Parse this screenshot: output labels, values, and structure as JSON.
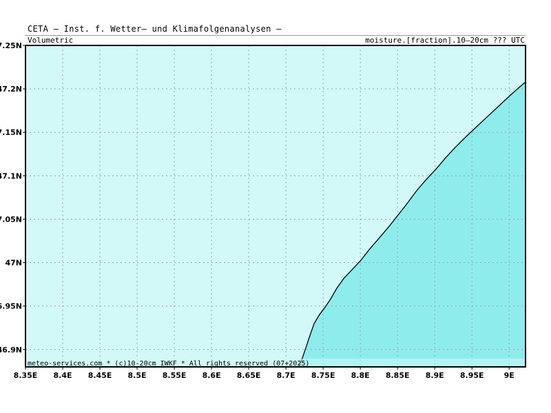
{
  "header": {
    "title": "CETA — Inst. f. Wetter— und Klimafolgenanalysen —",
    "left_label": "Volumetric",
    "right_label": "moisture.[fraction].10—20cm  ???  UTC"
  },
  "footer": {
    "copyright": "meteo-services.com * (c)10-20cm IWKF * All rights reserved (07+2025)"
  },
  "map": {
    "lon_range": [
      8.35,
      9.022
    ],
    "lat_range": [
      46.88,
      7.25
    ],
    "lat_axis_max": 47.25,
    "x_ticks": [
      {
        "value": 8.35,
        "label": "8.35E"
      },
      {
        "value": 8.4,
        "label": "8.4E"
      },
      {
        "value": 8.45,
        "label": "8.45E"
      },
      {
        "value": 8.5,
        "label": "8.5E"
      },
      {
        "value": 8.55,
        "label": "8.55E"
      },
      {
        "value": 8.6,
        "label": "8.6E"
      },
      {
        "value": 8.65,
        "label": "8.65E"
      },
      {
        "value": 8.7,
        "label": "8.7E"
      },
      {
        "value": 8.75,
        "label": "8.75E"
      },
      {
        "value": 8.8,
        "label": "8.8E"
      },
      {
        "value": 8.85,
        "label": "8.85E"
      },
      {
        "value": 8.9,
        "label": "8.9E"
      },
      {
        "value": 8.95,
        "label": "8.95E"
      },
      {
        "value": 9.0,
        "label": "9E"
      }
    ],
    "y_ticks": [
      {
        "value": 47.25,
        "label": "7.25N"
      },
      {
        "value": 47.2,
        "label": "47.2N"
      },
      {
        "value": 47.15,
        "label": "7.15N"
      },
      {
        "value": 47.1,
        "label": "47.1N"
      },
      {
        "value": 47.05,
        "label": "7.05N"
      },
      {
        "value": 47.0,
        "label": "47N"
      },
      {
        "value": 46.95,
        "label": "6.95N"
      },
      {
        "value": 46.9,
        "label": "46.9N"
      }
    ],
    "colors": {
      "background": "#d2f8f8",
      "filled_region": "#8eeced",
      "grid": "#a0a0a0",
      "contour": "#000000",
      "frame": "#000000"
    },
    "contour_points": [
      [
        8.717,
        46.88
      ],
      [
        8.722,
        46.89
      ],
      [
        8.728,
        46.905
      ],
      [
        8.733,
        46.918
      ],
      [
        8.738,
        46.93
      ],
      [
        8.745,
        46.94
      ],
      [
        8.752,
        46.948
      ],
      [
        8.76,
        46.958
      ],
      [
        8.768,
        46.97
      ],
      [
        8.778,
        46.982
      ],
      [
        8.79,
        46.993
      ],
      [
        8.8,
        47.002
      ],
      [
        8.812,
        47.015
      ],
      [
        8.825,
        47.028
      ],
      [
        8.838,
        47.041
      ],
      [
        8.85,
        47.054
      ],
      [
        8.862,
        47.067
      ],
      [
        8.875,
        47.082
      ],
      [
        8.888,
        47.095
      ],
      [
        8.902,
        47.108
      ],
      [
        8.915,
        47.121
      ],
      [
        8.928,
        47.133
      ],
      [
        8.942,
        47.145
      ],
      [
        8.957,
        47.157
      ],
      [
        8.972,
        47.169
      ],
      [
        8.987,
        47.181
      ],
      [
        9.002,
        47.193
      ],
      [
        9.022,
        47.208
      ]
    ]
  }
}
